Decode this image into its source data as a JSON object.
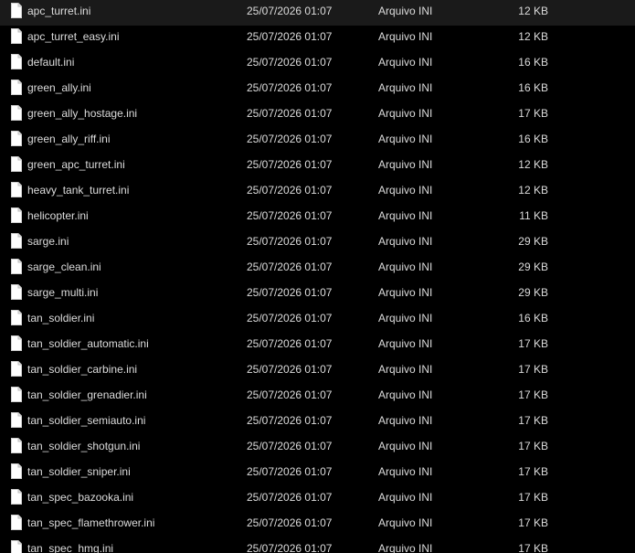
{
  "icons": {
    "file": "ini-file-icon"
  },
  "colors": {
    "background": "#000000",
    "text": "#dcdcdc"
  },
  "files": [
    {
      "name": "apc_turret.ini",
      "modified": "25/07/2026 01:07",
      "type": "Arquivo INI",
      "size": "12 KB"
    },
    {
      "name": "apc_turret_easy.ini",
      "modified": "25/07/2026 01:07",
      "type": "Arquivo INI",
      "size": "12 KB"
    },
    {
      "name": "default.ini",
      "modified": "25/07/2026 01:07",
      "type": "Arquivo INI",
      "size": "16 KB"
    },
    {
      "name": "green_ally.ini",
      "modified": "25/07/2026 01:07",
      "type": "Arquivo INI",
      "size": "16 KB"
    },
    {
      "name": "green_ally_hostage.ini",
      "modified": "25/07/2026 01:07",
      "type": "Arquivo INI",
      "size": "17 KB"
    },
    {
      "name": "green_ally_riff.ini",
      "modified": "25/07/2026 01:07",
      "type": "Arquivo INI",
      "size": "16 KB"
    },
    {
      "name": "green_apc_turret.ini",
      "modified": "25/07/2026 01:07",
      "type": "Arquivo INI",
      "size": "12 KB"
    },
    {
      "name": "heavy_tank_turret.ini",
      "modified": "25/07/2026 01:07",
      "type": "Arquivo INI",
      "size": "12 KB"
    },
    {
      "name": "helicopter.ini",
      "modified": "25/07/2026 01:07",
      "type": "Arquivo INI",
      "size": "11 KB"
    },
    {
      "name": "sarge.ini",
      "modified": "25/07/2026 01:07",
      "type": "Arquivo INI",
      "size": "29 KB"
    },
    {
      "name": "sarge_clean.ini",
      "modified": "25/07/2026 01:07",
      "type": "Arquivo INI",
      "size": "29 KB"
    },
    {
      "name": "sarge_multi.ini",
      "modified": "25/07/2026 01:07",
      "type": "Arquivo INI",
      "size": "29 KB"
    },
    {
      "name": "tan_soldier.ini",
      "modified": "25/07/2026 01:07",
      "type": "Arquivo INI",
      "size": "16 KB"
    },
    {
      "name": "tan_soldier_automatic.ini",
      "modified": "25/07/2026 01:07",
      "type": "Arquivo INI",
      "size": "17 KB"
    },
    {
      "name": "tan_soldier_carbine.ini",
      "modified": "25/07/2026 01:07",
      "type": "Arquivo INI",
      "size": "17 KB"
    },
    {
      "name": "tan_soldier_grenadier.ini",
      "modified": "25/07/2026 01:07",
      "type": "Arquivo INI",
      "size": "17 KB"
    },
    {
      "name": "tan_soldier_semiauto.ini",
      "modified": "25/07/2026 01:07",
      "type": "Arquivo INI",
      "size": "17 KB"
    },
    {
      "name": "tan_soldier_shotgun.ini",
      "modified": "25/07/2026 01:07",
      "type": "Arquivo INI",
      "size": "17 KB"
    },
    {
      "name": "tan_soldier_sniper.ini",
      "modified": "25/07/2026 01:07",
      "type": "Arquivo INI",
      "size": "17 KB"
    },
    {
      "name": "tan_spec_bazooka.ini",
      "modified": "25/07/2026 01:07",
      "type": "Arquivo INI",
      "size": "17 KB"
    },
    {
      "name": "tan_spec_flamethrower.ini",
      "modified": "25/07/2026 01:07",
      "type": "Arquivo INI",
      "size": "17 KB"
    },
    {
      "name": "tan_spec_hmg.ini",
      "modified": "25/07/2026 01:07",
      "type": "Arquivo INI",
      "size": "17 KB"
    }
  ]
}
